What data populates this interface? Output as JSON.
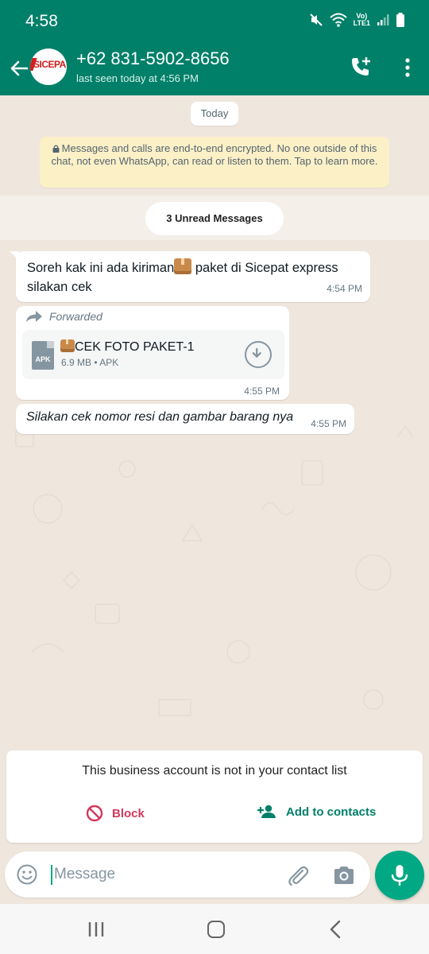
{
  "status_bar": {
    "time": "4:58",
    "network_label_top": "Vo)",
    "network_label_bottom": "LTE1"
  },
  "header": {
    "contact_name": "+62 831-5902-8656",
    "last_seen": "last seen today at 4:56 PM",
    "avatar_text": "SICEPA",
    "icons": [
      "back-arrow-icon",
      "add-call-icon",
      "more-vertical-icon"
    ]
  },
  "chat": {
    "date_label": "Today",
    "encryption_notice": "Messages and calls are end-to-end encrypted. No one outside of this chat, not even WhatsApp, can read or listen to them. Tap to learn more.",
    "unread_label": "3 Unread Messages",
    "messages": [
      {
        "text_before": "Soreh kak ini ada kiriman",
        "text_after": " paket di Sicepat express silakan cek",
        "time": "4:54 PM"
      },
      {
        "forwarded_label": "Forwarded",
        "file_name": "CEK FOTO PAKET-1",
        "file_meta": "6.9 MB • APK",
        "file_icon_text": "APK",
        "time": "4:55 PM"
      },
      {
        "text": "Silakan cek nomor resi dan gambar barang nya",
        "time": "4:55 PM"
      }
    ]
  },
  "business_card": {
    "notice": "This business account is not in your contact list",
    "block_label": "Block",
    "add_label": "Add to contacts",
    "block_color": "#d1385d",
    "add_color": "#008069"
  },
  "composer": {
    "placeholder": "Message"
  },
  "colors": {
    "header": "#008069",
    "accent": "#00a884",
    "chat_bg": "#efe7dd"
  }
}
